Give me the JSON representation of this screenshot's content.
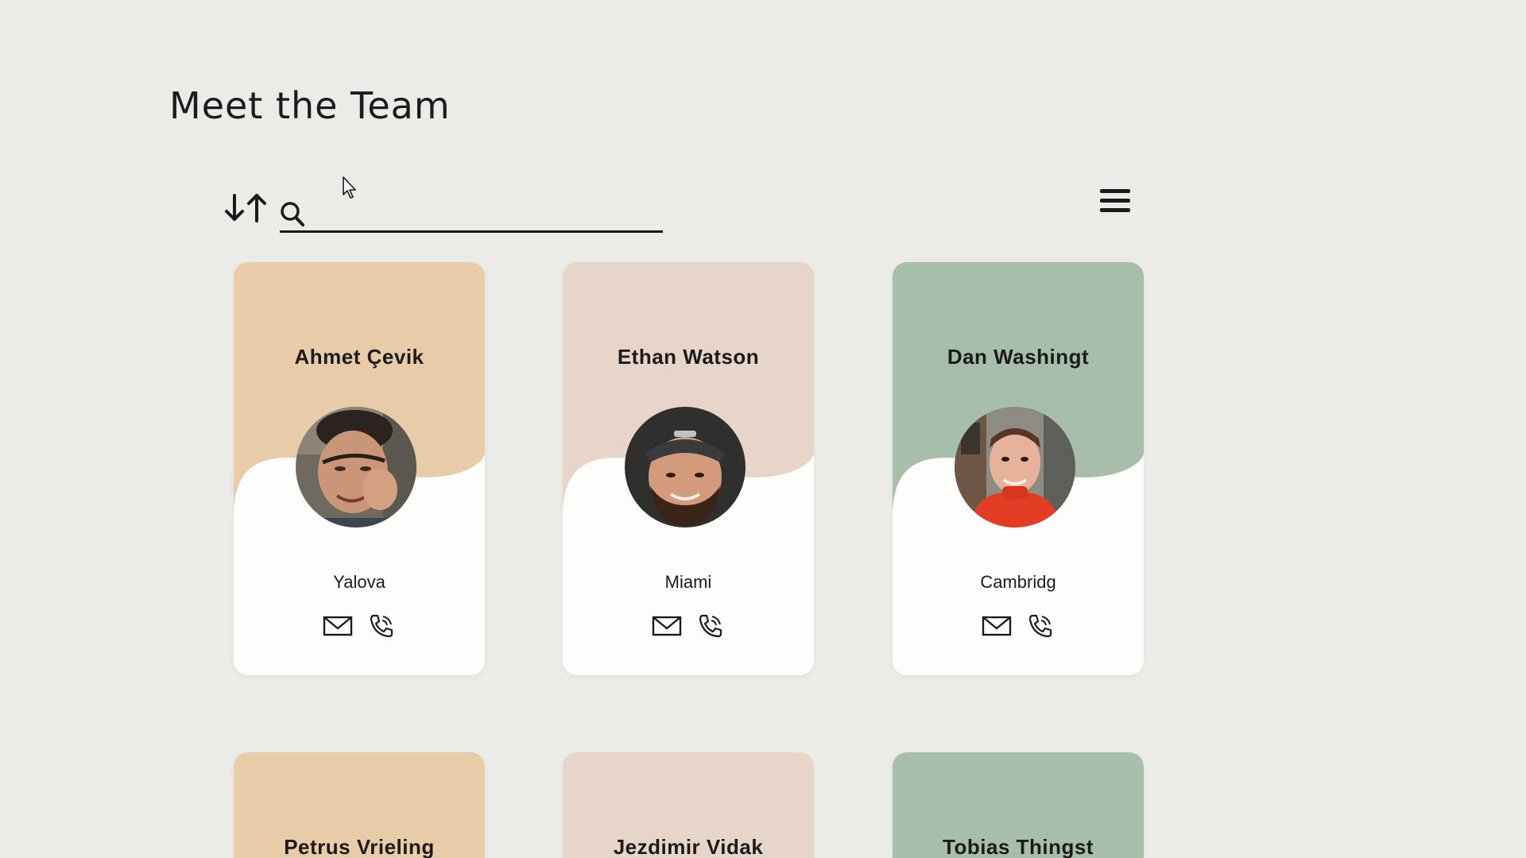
{
  "page": {
    "title": "Meet the Team"
  },
  "search": {
    "value": "",
    "placeholder": ""
  },
  "toolbar": {
    "sort_icon": "sort-arrows-icon",
    "search_icon": "search-icon",
    "menu_icon": "hamburger-menu-icon"
  },
  "icons": {
    "email": "envelope-icon",
    "phone": "phone-icon"
  },
  "colors": {
    "peach": "#e8ccaa",
    "blush": "#e7d5ca",
    "sage": "#a6beaa",
    "text": "#1b1b1b",
    "background": "#ebebe7"
  },
  "members": [
    {
      "name": "Ahmet Çevik",
      "city": "Yalova",
      "color": "#e8ccaa"
    },
    {
      "name": "Ethan Watson",
      "city": "Miami",
      "color": "#e7d5ca"
    },
    {
      "name": "Dan Washingt",
      "city": "Cambridg",
      "color": "#a6beaa"
    },
    {
      "name": "Petrus Vrieling",
      "city": "",
      "color": "#e8ccaa"
    },
    {
      "name": "Jezdimir Vidak",
      "city": "",
      "color": "#e7d5ca"
    },
    {
      "name": "Tobias Thingst",
      "city": "",
      "color": "#a6beaa"
    }
  ]
}
